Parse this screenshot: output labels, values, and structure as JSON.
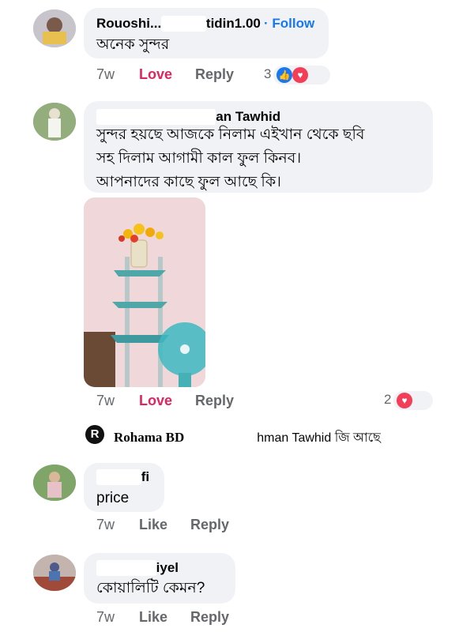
{
  "comments": [
    {
      "author_visible_start": "Rouoshi...",
      "author_visible_end": "tidin1.00",
      "follow_label": "· Follow",
      "text_lines": [
        "অনেক সুন্দর"
      ],
      "time": "7w",
      "react_label": "Love",
      "reply_label": "Reply",
      "reaction_count": "3",
      "reaction_icons": [
        "like-icon",
        "love-icon"
      ]
    },
    {
      "author_visible": "an Tawhid",
      "text_lines": [
        "সুন্দর হয়ছে আজকে নিলাম এইখান থেকে ছবি",
        "সহ দিলাম আগামী কাল ফুল কিনব।",
        "আপনাদের কাছে ফুল আছে কি।"
      ],
      "time": "7w",
      "react_label": "Love",
      "reply_label": "Reply",
      "reaction_count": "2",
      "reaction_icons": [
        "love-icon"
      ]
    },
    {
      "author_visible": "fi",
      "text_lines": [
        "price"
      ],
      "time": "7w",
      "react_label": "Like",
      "reply_label": "Reply"
    },
    {
      "author_visible": "iyel",
      "text_lines": [
        "কোয়ালিটি কেমন?"
      ],
      "time": "7w",
      "react_label": "Like",
      "reply_label": "Reply"
    }
  ],
  "reply_preview": {
    "logo_letter": "R",
    "author": "Rohama BD",
    "mention_visible": "hman Tawhid",
    "text": "জি আছে"
  },
  "colors": {
    "love": "#e0245e",
    "follow": "#1877f2",
    "muted": "#65676b",
    "bubble": "#f0f2f5"
  }
}
